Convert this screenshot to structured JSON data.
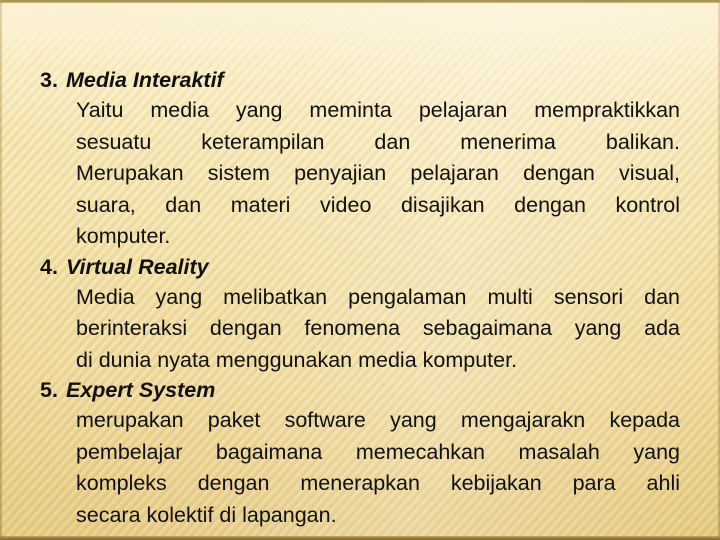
{
  "slide": {
    "background": {
      "top_color": "#fcf2d2",
      "mid_color": "#f3e0a4",
      "bottom_color": "#e2c578",
      "edge_color": "#8d7a3c",
      "texture": "diagonal-stripes"
    },
    "text_color": "#111111",
    "items": [
      {
        "number": "3.",
        "title": "Media Interaktif",
        "lines": [
          "Yaitu media yang meminta pelajaran mempraktikkan",
          "sesuatu keterampilan dan menerima balikan.",
          "Merupakan sistem penyajian pelajaran dengan visual,",
          "suara, dan materi video disajikan dengan kontrol",
          "komputer."
        ],
        "body": "Yaitu media yang meminta pelajaran mempraktikkan sesuatu keterampilan dan menerima balikan. Merupakan sistem penyajian pelajaran dengan visual, suara, dan materi video disajikan dengan kontrol komputer."
      },
      {
        "number": "4.",
        "title": "Virtual Reality",
        "lines": [
          "Media yang melibatkan pengalaman multi sensori dan",
          "berinteraksi dengan fenomena sebagaimana yang ada",
          "di dunia nyata menggunakan media komputer."
        ],
        "body": "Media yang melibatkan pengalaman multi sensori dan berinteraksi dengan fenomena sebagaimana yang ada di dunia nyata menggunakan media komputer."
      },
      {
        "number": "5.",
        "title": "Expert System",
        "lines": [
          "merupakan paket software yang mengajarakn kepada",
          "pembelajar bagaimana memecahkan masalah yang",
          "kompleks dengan menerapkan kebijakan para ahli",
          "secara kolektif di lapangan."
        ],
        "body": "merupakan paket software yang mengajarakn kepada pembelajar bagaimana memecahkan masalah yang kompleks dengan menerapkan kebijakan para ahli secara kolektif di lapangan."
      }
    ]
  }
}
